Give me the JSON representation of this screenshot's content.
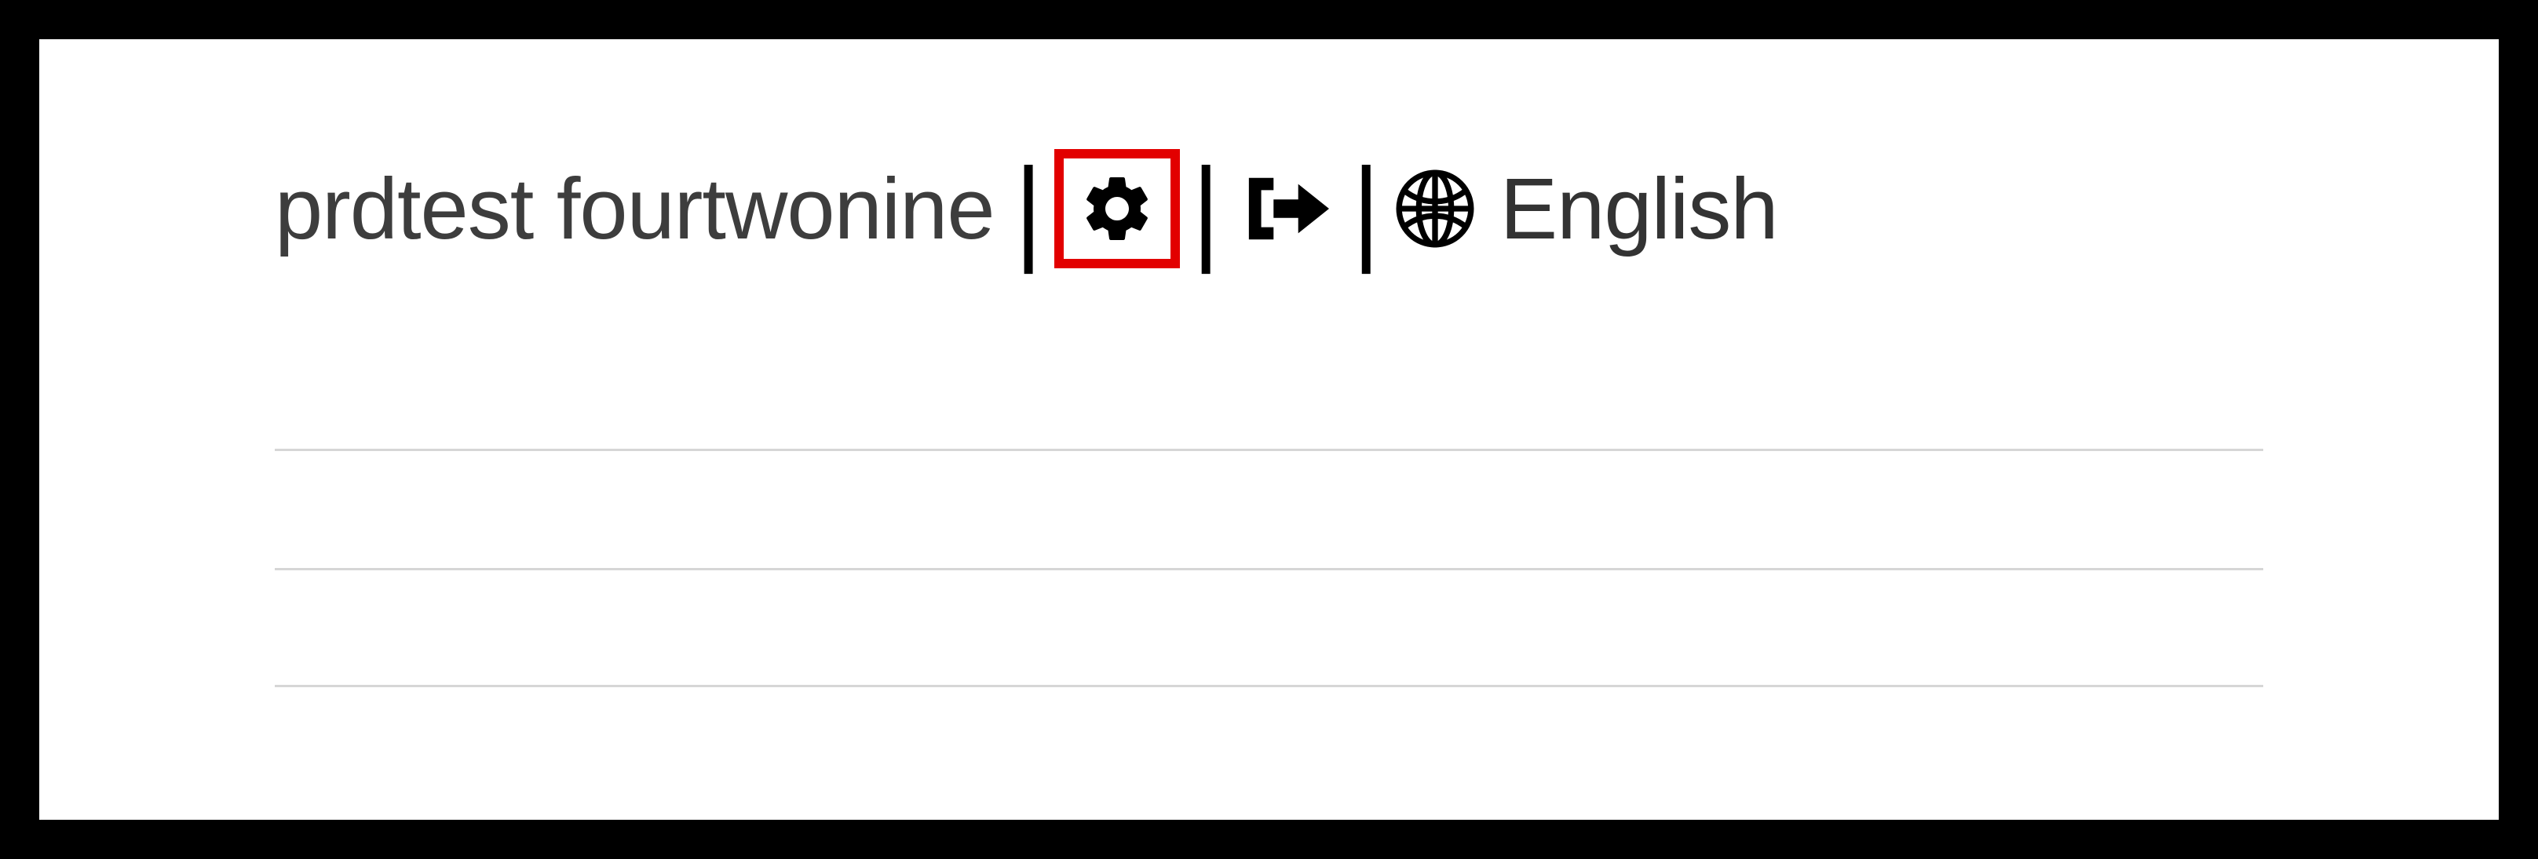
{
  "header": {
    "username": "prdtest fourtwonine",
    "language": "English",
    "icons": {
      "settings": "gear-icon",
      "logout": "logout-icon",
      "globe": "globe-icon"
    },
    "highlighted": "settings"
  }
}
